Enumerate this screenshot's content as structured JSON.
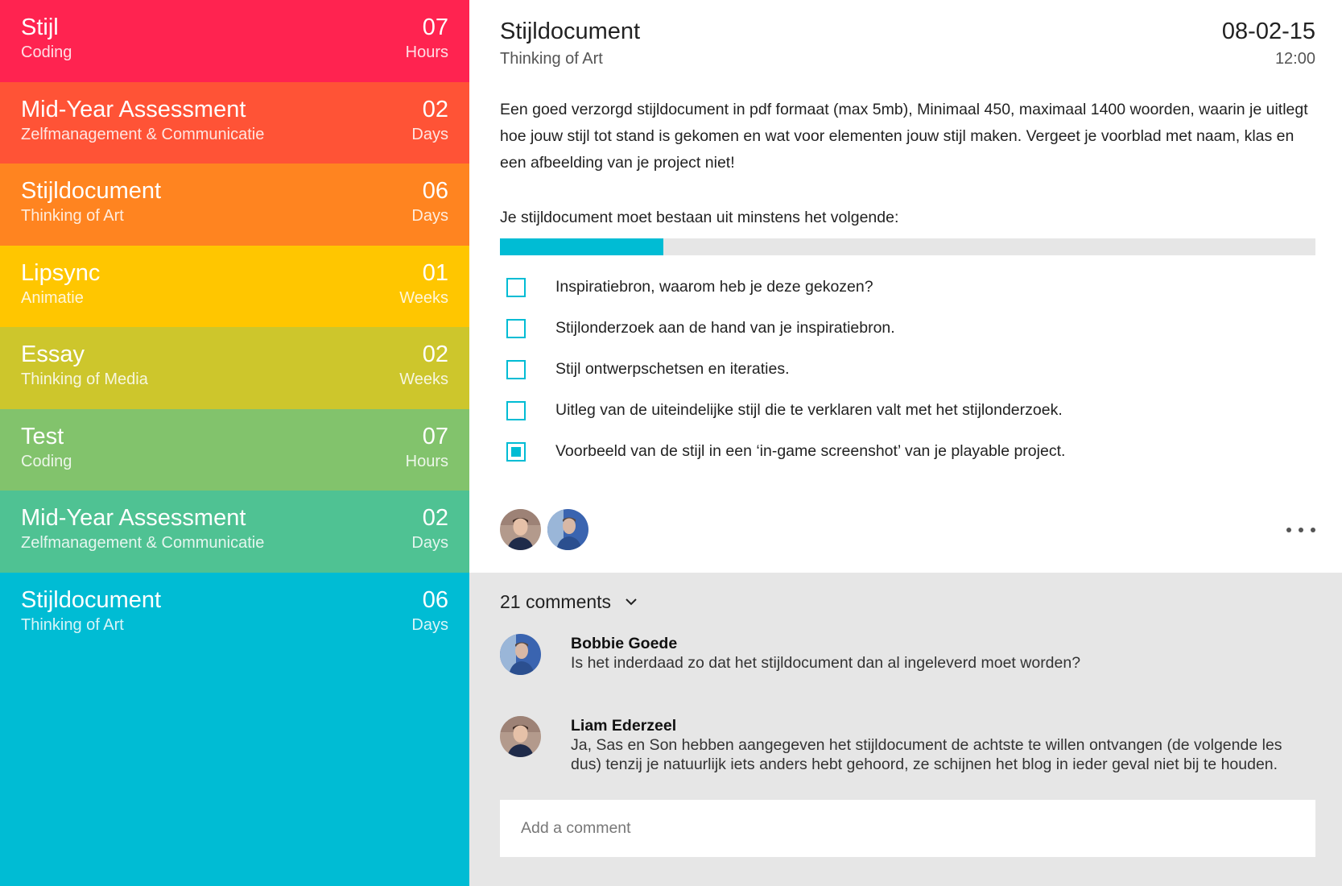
{
  "sidebar": {
    "items": [
      {
        "name": "Stijl",
        "course": "Coding",
        "count": "07",
        "unit": "Hours",
        "color": "#ff2350"
      },
      {
        "name": "Mid-Year Assessment",
        "course": "Zelfmanagement & Communicatie",
        "count": "02",
        "unit": "Days",
        "color": "#ff5336"
      },
      {
        "name": "Stijldocument",
        "course": "Thinking of Art",
        "count": "06",
        "unit": "Days",
        "color": "#ff8420"
      },
      {
        "name": "Lipsync",
        "course": "Animatie",
        "count": "01",
        "unit": "Weeks",
        "color": "#ffc600"
      },
      {
        "name": "Essay",
        "course": "Thinking of Media",
        "count": "02",
        "unit": "Weeks",
        "color": "#cdc62c"
      },
      {
        "name": "Test",
        "course": "Coding",
        "count": "07",
        "unit": "Hours",
        "color": "#82c36c"
      },
      {
        "name": "Mid-Year Assessment",
        "course": "Zelfmanagement & Communicatie",
        "count": "02",
        "unit": "Days",
        "color": "#4fc293"
      },
      {
        "name": "Stijldocument",
        "course": "Thinking of Art",
        "count": "06",
        "unit": "Days",
        "color": "#00bcd4"
      }
    ]
  },
  "detail": {
    "title": "Stijldocument",
    "subtitle": "Thinking of Art",
    "date": "08-02-15",
    "time": "12:00",
    "description": "Een goed verzorgd stijldocument in pdf formaat (max 5mb), Minimaal 450, maximaal 1400 woorden, waarin je uitlegt hoe jouw stijl tot stand is gekomen en wat voor elementen jouw stijl maken.  Vergeet je voorblad met naam, klas en een afbeelding van je project niet!",
    "requirements_intro": "Je stijldocument moet bestaan uit minstens het volgende:",
    "progress": 0.2,
    "accent_color": "#00bcd4",
    "checklist": [
      {
        "label": "Inspiratiebron, waarom heb je deze gekozen?",
        "checked": false
      },
      {
        "label": "Stijlonderzoek aan de hand van je inspiratiebron.",
        "checked": false
      },
      {
        "label": "Stijl ontwerpschetsen en iteraties.",
        "checked": false
      },
      {
        "label": "Uitleg van de uiteindelijke stijl die te verklaren valt met het stijlonderzoek.",
        "checked": false
      },
      {
        "label": "Voorbeeld van de stijl in een ‘in-game screenshot’ van je playable project.",
        "checked": true
      }
    ],
    "members": [
      "avatar-1",
      "avatar-2"
    ],
    "more_icon": "more-horizontal-icon"
  },
  "comments": {
    "count_label": "21 comments",
    "toggle_icon": "chevron-down-icon",
    "items": [
      {
        "author": "Bobbie Goede",
        "text": "Is het inderdaad zo dat het stijldocument dan al ingeleverd moet worden?"
      },
      {
        "author": "Liam Ederzeel",
        "text": "Ja, Sas en Son hebben aangegeven het stijldocument de achtste te willen ontvangen (de volgende les dus) tenzij je natuurlijk iets anders hebt gehoord, ze schijnen het blog in ieder geval niet bij te houden."
      }
    ],
    "input_placeholder": "Add a comment"
  }
}
